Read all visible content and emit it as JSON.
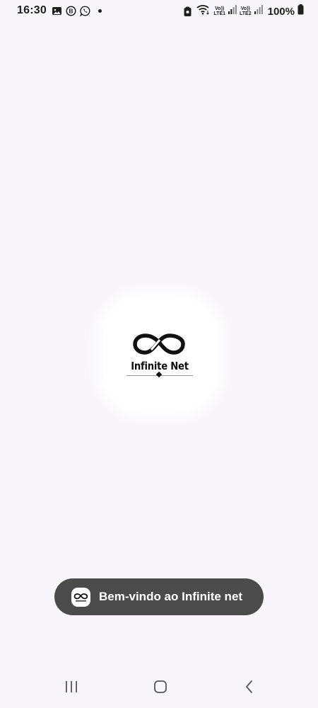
{
  "status_bar": {
    "time": "16:30",
    "notification_icons": [
      "gallery-icon",
      "b-badge-icon",
      "whatsapp-icon",
      "dot-icon"
    ],
    "sim1_label_top": "Vo))",
    "sim1_label_bottom": "LTE1",
    "sim2_label_top": "Vo))",
    "sim2_label_bottom": "LTE2",
    "battery_percent": "100%"
  },
  "splash": {
    "brand_name": "Infinite Net"
  },
  "toast": {
    "message": "Bem-vindo ao Infinite net"
  },
  "nav_bar": {
    "buttons": [
      "recent-apps",
      "home",
      "back"
    ]
  },
  "colors": {
    "background": "#f8f6fa",
    "toast_background": "#4b4b4b",
    "text_dark": "#1f1f1f"
  }
}
